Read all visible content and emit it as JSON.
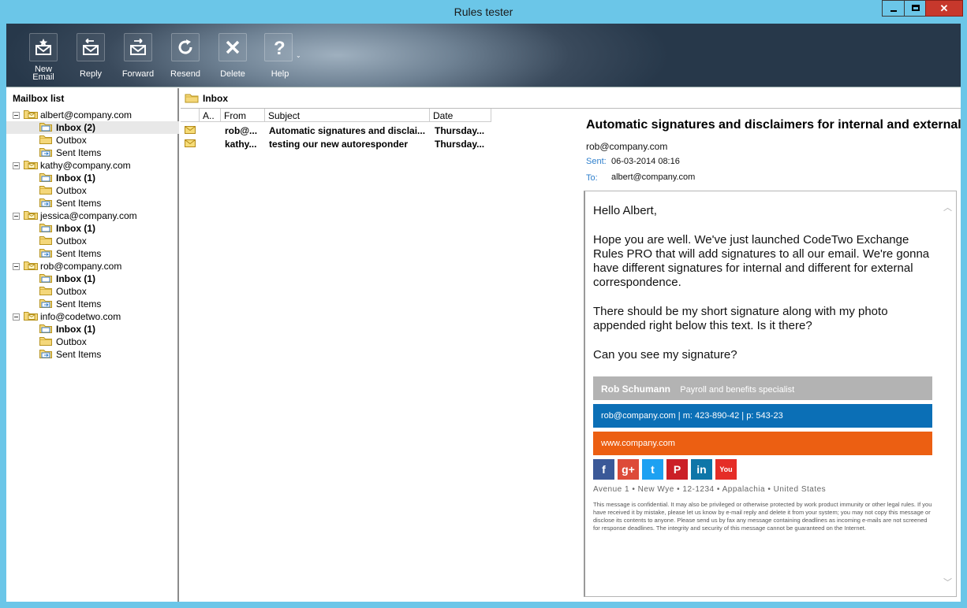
{
  "window": {
    "title": "Rules tester"
  },
  "toolbar": {
    "new_email": "New Email",
    "new_email_l1": "New",
    "new_email_l2": "Email",
    "reply": "Reply",
    "forward": "Forward",
    "resend": "Resend",
    "delete": "Delete",
    "help": "Help"
  },
  "mailbox_list": {
    "header": "Mailbox list",
    "accounts": [
      {
        "email": "albert@company.com",
        "inbox": "Inbox (2)",
        "outbox": "Outbox",
        "sent": "Sent Items"
      },
      {
        "email": "kathy@company.com",
        "inbox": "Inbox (1)",
        "outbox": "Outbox",
        "sent": "Sent Items"
      },
      {
        "email": "jessica@company.com",
        "inbox": "Inbox (1)",
        "outbox": "Outbox",
        "sent": "Sent Items"
      },
      {
        "email": "rob@company.com",
        "inbox": "Inbox (1)",
        "outbox": "Outbox",
        "sent": "Sent Items"
      },
      {
        "email": "info@codetwo.com",
        "inbox": "Inbox (1)",
        "outbox": "Outbox",
        "sent": "Sent Items"
      }
    ]
  },
  "folder": {
    "title": "Inbox"
  },
  "message_list": {
    "columns": {
      "attach": "A..",
      "from": "From",
      "subject": "Subject",
      "date": "Date"
    },
    "rows": [
      {
        "from": "rob@...",
        "subject": "Automatic signatures and disclai...",
        "date": "Thursday..."
      },
      {
        "from": "kathy...",
        "subject": "testing our new autoresponder",
        "date": "Thursday..."
      }
    ]
  },
  "reading_pane": {
    "subject": "Automatic signatures and disclaimers for internal and external",
    "sender": "rob@company.com",
    "sent_label": "Sent:",
    "sent_value": "06-03-2014 08:16",
    "to_label": "To:",
    "to_value": "albert@company.com",
    "body": {
      "greeting": "Hello Albert,",
      "p1": "Hope you are well. We've just launched CodeTwo Exchange Rules PRO that will add signatures to all our email. We're gonna have different signatures for internal and different for external correspondence.",
      "p2": "There should be my short signature along with my photo appended right below this text. Is it there?",
      "p3": "Can you see my signature?"
    },
    "signature": {
      "name": "Rob Schumann",
      "role": "Payroll and benefits specialist",
      "contact": "rob@company.com |  m:  423-890-42 | p: 543-23",
      "website": "www.company.com",
      "address": "Avenue 1 • New Wye  • 12-1234 • Appalachia • United States",
      "disclaimer": "This message is confidential. It may also be privileged or otherwise protected by work product immunity or other legal rules. If you have received it by mistake, please let us know by e-mail reply and delete it from your system; you may not copy this message or disclose its contents to anyone. Please send us by fax any message containing deadlines as incoming e-mails are not screened for response deadlines. The integrity and security of this message cannot be guaranteed on the Internet.",
      "colors": {
        "name_bar": "#b3b3b3",
        "contact_bar": "#0b6fb6",
        "web_bar": "#ec5f12"
      },
      "social": [
        {
          "icon": "facebook-icon",
          "glyph": "f",
          "color": "#3b5998"
        },
        {
          "icon": "google-plus-icon",
          "glyph": "g+",
          "color": "#dd4b39"
        },
        {
          "icon": "twitter-icon",
          "glyph": "t",
          "color": "#1da1f2"
        },
        {
          "icon": "pinterest-icon",
          "glyph": "P",
          "color": "#cb2027"
        },
        {
          "icon": "linkedin-icon",
          "glyph": "in",
          "color": "#0e76a8"
        },
        {
          "icon": "youtube-icon",
          "glyph": "You",
          "color": "#e52d27"
        }
      ]
    }
  }
}
